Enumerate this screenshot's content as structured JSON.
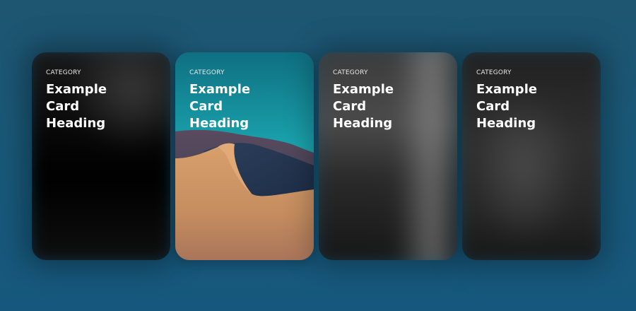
{
  "cards": [
    {
      "category": "CATEGORY",
      "heading": "Example Card Heading",
      "image": "dark-abstract",
      "state": "blurred"
    },
    {
      "category": "CATEGORY",
      "heading": "Example Card Heading",
      "image": "sand-dune",
      "state": "focused"
    },
    {
      "category": "CATEGORY",
      "heading": "Example Card Heading",
      "image": "grey-abstract",
      "state": "blurred"
    },
    {
      "category": "CATEGORY",
      "heading": "Example Card Heading",
      "image": "dark-grey-abstract",
      "state": "blurred"
    }
  ],
  "colors": {
    "background": "#1a5878",
    "text": "#ffffff",
    "dune_sand": "#c99566",
    "sky_teal": "#18a2ad"
  }
}
